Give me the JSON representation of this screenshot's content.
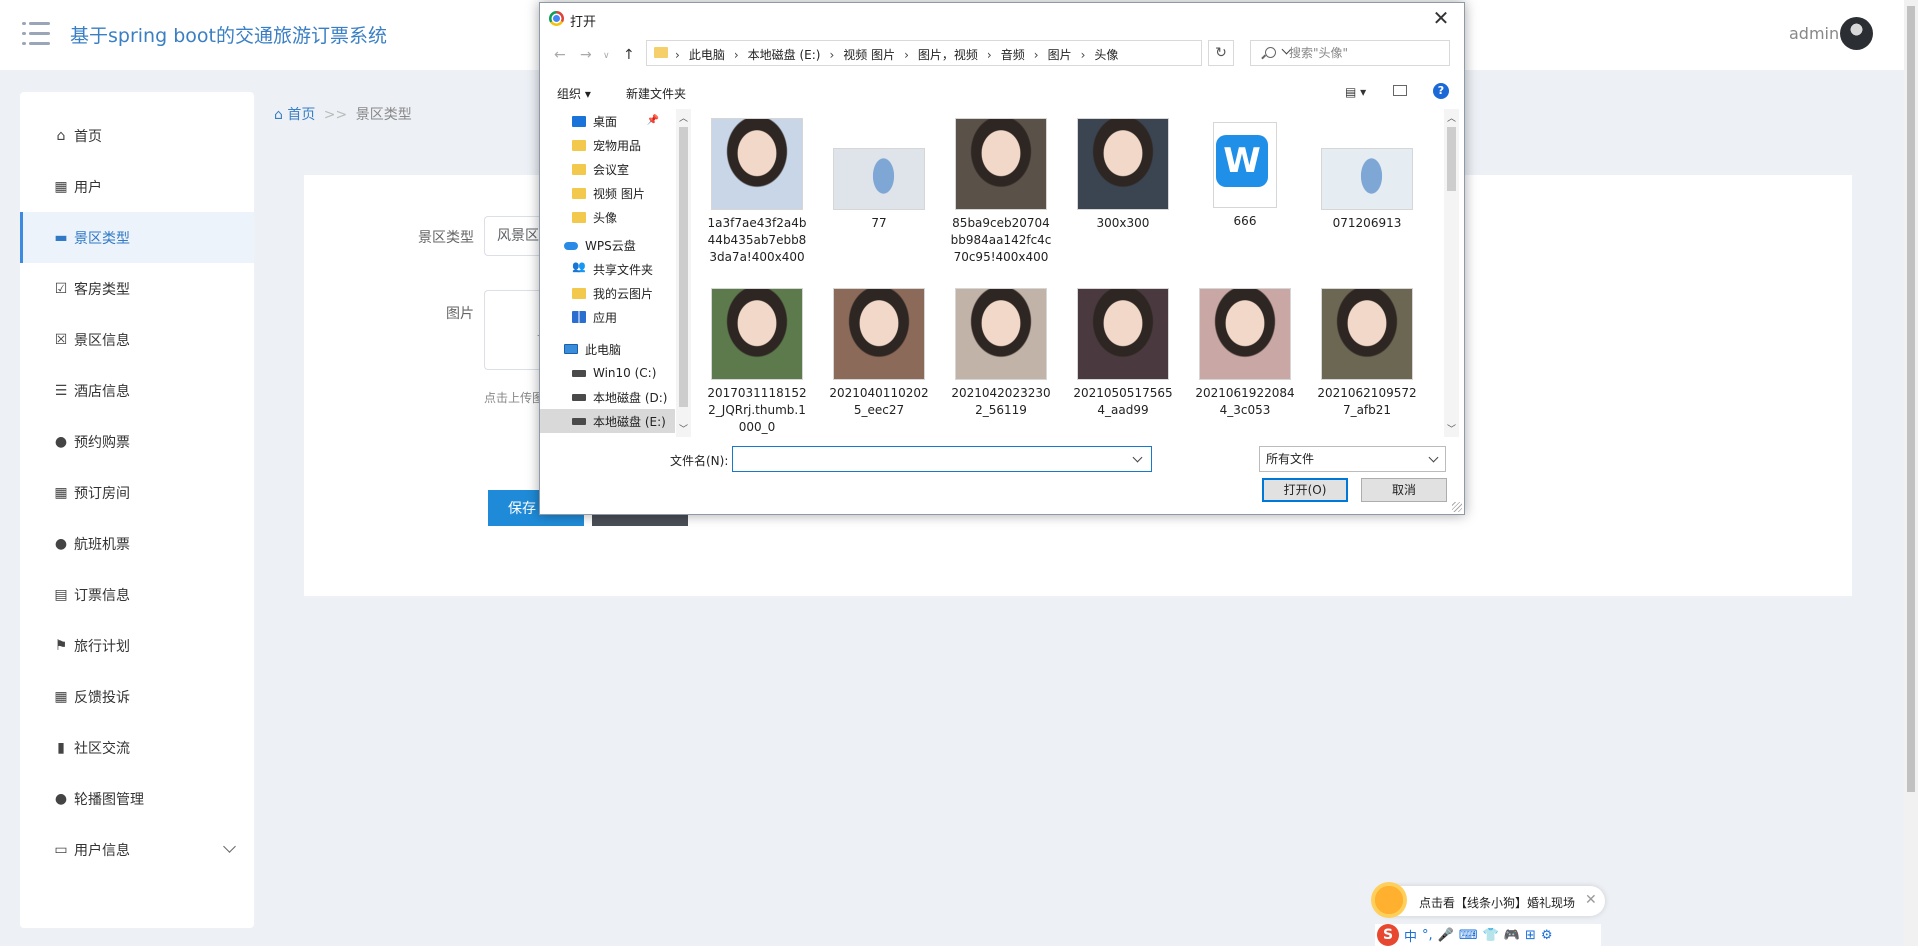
{
  "app": {
    "title": "基于spring boot的交通旅游订票系统",
    "user": "admin"
  },
  "sidebar": {
    "items": [
      {
        "label": "首页",
        "icon": "home-icon"
      },
      {
        "label": "用户",
        "icon": "grid-icon"
      },
      {
        "label": "景区类型",
        "icon": "chat-icon"
      },
      {
        "label": "客房类型",
        "icon": "clipboard-check-icon"
      },
      {
        "label": "景区信息",
        "icon": "clipboard-x-icon"
      },
      {
        "label": "酒店信息",
        "icon": "sliders-icon"
      },
      {
        "label": "预约购票",
        "icon": "user-icon"
      },
      {
        "label": "预订房间",
        "icon": "grid-icon"
      },
      {
        "label": "航班机票",
        "icon": "user-icon"
      },
      {
        "label": "订票信息",
        "icon": "clipboard-icon"
      },
      {
        "label": "旅行计划",
        "icon": "flag-icon"
      },
      {
        "label": "反馈投诉",
        "icon": "grid-icon"
      },
      {
        "label": "社区交流",
        "icon": "stamp-icon"
      },
      {
        "label": "轮播图管理",
        "icon": "pin-icon"
      },
      {
        "label": "用户信息",
        "icon": "window-icon"
      }
    ],
    "active_index": 2
  },
  "breadcrumb": {
    "home": "首页",
    "separator": ">>",
    "current": "景区类型"
  },
  "form": {
    "type_label": "景区类型",
    "type_value": "风景区",
    "image_label": "图片",
    "upload_hint": "点击上传图",
    "save_label": "保存"
  },
  "dialog": {
    "title": "打开",
    "path": [
      "此电脑",
      "本地磁盘 (E:)",
      "视频 图片",
      "图片，视频",
      "音频",
      "图片",
      "头像"
    ],
    "search_placeholder": "搜索\"头像\"",
    "toolbar": {
      "organize": "组织 ▾",
      "new_folder": "新建文件夹",
      "help": "?"
    },
    "tree": [
      {
        "label": "桌面",
        "icon": "desktop-icon"
      },
      {
        "label": "宠物用品",
        "icon": "folder-icon"
      },
      {
        "label": "会议室",
        "icon": "folder-icon"
      },
      {
        "label": "视频 图片",
        "icon": "folder-icon"
      },
      {
        "label": "头像",
        "icon": "folder-icon"
      },
      {
        "label": "WPS云盘",
        "icon": "cloud-icon"
      },
      {
        "label": "共享文件夹",
        "icon": "share-icon"
      },
      {
        "label": "我的云图片",
        "icon": "folder-icon"
      },
      {
        "label": "应用",
        "icon": "apps-icon"
      },
      {
        "label": "此电脑",
        "icon": "pc-icon"
      },
      {
        "label": "Win10 (C:)",
        "icon": "drive-icon"
      },
      {
        "label": "本地磁盘 (D:)",
        "icon": "drive-icon"
      },
      {
        "label": "本地磁盘 (E:)",
        "icon": "drive-icon"
      }
    ],
    "files": [
      {
        "name": "1a3f7ae43f2a4b44b435ab7ebb83da7a!400x400",
        "kind": "portrait",
        "color": "#c9d6e8"
      },
      {
        "name": "77",
        "kind": "wide",
        "color": "#dfe3ea"
      },
      {
        "name": "85ba9ceb20704bb984aa142fc4c70c95!400x400",
        "kind": "portrait",
        "color": "#5a5149"
      },
      {
        "name": "300x300",
        "kind": "portrait",
        "color": "#3b4552"
      },
      {
        "name": "666",
        "kind": "wps-doc",
        "color": "#1f8fe8"
      },
      {
        "name": "071206913",
        "kind": "wide",
        "color": "#e6edf2"
      },
      {
        "name": "20170311181522_JQRrj.thumb.1000_0",
        "kind": "portrait",
        "color": "#5d7a4c"
      },
      {
        "name": "20210401102025_eec27",
        "kind": "portrait",
        "color": "#8b6a5a"
      },
      {
        "name": "20210420232302_56119",
        "kind": "portrait",
        "color": "#c2b3a8"
      },
      {
        "name": "20210505175654_aad99",
        "kind": "portrait",
        "color": "#4a3a40"
      },
      {
        "name": "20210619220844_3c053",
        "kind": "portrait",
        "color": "#c9a7a5"
      },
      {
        "name": "20210621095727_afb21",
        "kind": "portrait",
        "color": "#6b6753"
      }
    ],
    "filename_label": "文件名(N):",
    "filename_value": "",
    "filetype": "所有文件",
    "open_label": "打开(O)",
    "cancel_label": "取消"
  },
  "notification": {
    "text": "点击看【线条小狗】婚礼现场"
  },
  "ime": {
    "logo": "S",
    "items": [
      "中",
      "°,",
      "🎤",
      "⌨",
      "👕",
      "🎮",
      "⊞",
      "⚙"
    ]
  }
}
